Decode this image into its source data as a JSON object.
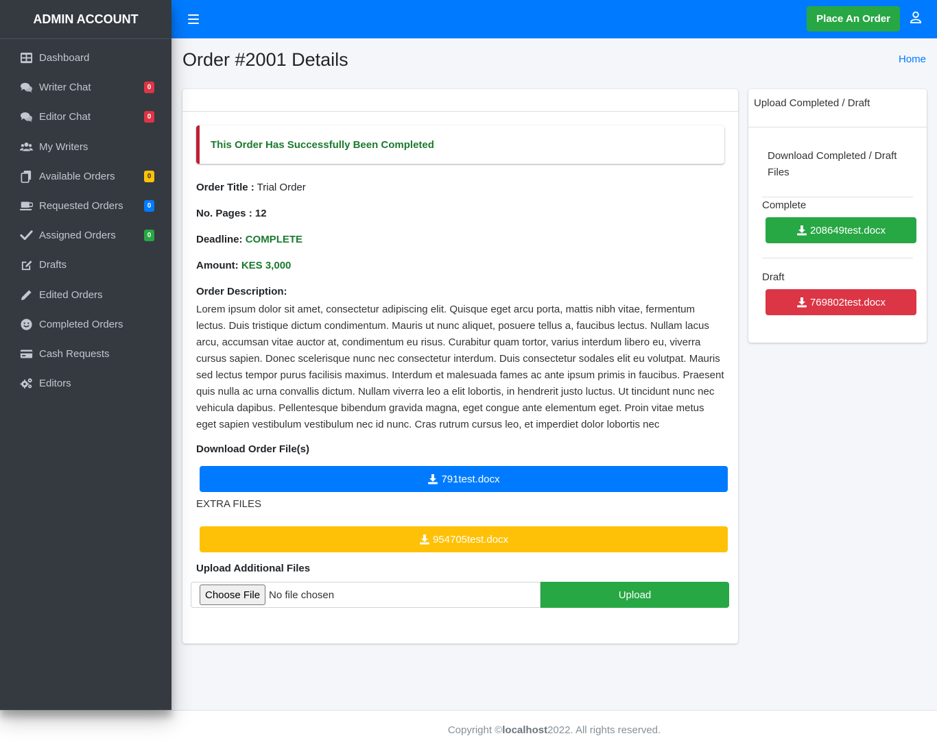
{
  "sidebar": {
    "brand": "ADMIN ACCOUNT",
    "items": [
      {
        "label": "Dashboard",
        "icon": "dashboard-icon"
      },
      {
        "label": "Writer Chat",
        "icon": "comments-icon",
        "badge": "0",
        "badge_color": "#dc3545"
      },
      {
        "label": "Editor Chat",
        "icon": "comments-icon",
        "badge": "0",
        "badge_color": "#dc3545"
      },
      {
        "label": "My Writers",
        "icon": "users-icon"
      },
      {
        "label": "Available Orders",
        "icon": "copy-icon",
        "badge": "0",
        "badge_color": "#ffc107"
      },
      {
        "label": "Requested Orders",
        "icon": "mug-icon",
        "badge": "0",
        "badge_color": "#007bff"
      },
      {
        "label": "Assigned Orders",
        "icon": "check-icon",
        "badge": "0",
        "badge_color": "#28a745"
      },
      {
        "label": "Drafts",
        "icon": "edit-icon"
      },
      {
        "label": "Edited Orders",
        "icon": "pencil-icon"
      },
      {
        "label": "Completed Orders",
        "icon": "smile-icon"
      },
      {
        "label": "Cash Requests",
        "icon": "credit-card-icon"
      },
      {
        "label": "Editors",
        "icon": "cogs-icon"
      }
    ]
  },
  "topbar": {
    "menu_icon": "hamburger-icon",
    "place_order_label": "Place An Order",
    "user_icon": "user-icon"
  },
  "header": {
    "title": "Order #2001 Details",
    "breadcrumb_home": "Home"
  },
  "order": {
    "status_message": "This Order Has Successfully Been Completed",
    "title_label": "Order Title :",
    "title_value": "Trial Order",
    "pages_label": "No. Pages :",
    "pages_value": "12",
    "deadline_label": "Deadline:",
    "deadline_value": "COMPLETE",
    "amount_label": "Amount:",
    "amount_value": "KES 3,000",
    "description_label": "Order Description:",
    "description": "Lorem ipsum dolor sit amet, consectetur adipiscing elit. Quisque eget arcu porta, mattis nibh vitae, fermentum lectus. Duis tristique dictum condimentum. Mauris ut nunc aliquet, posuere tellus a, faucibus lectus. Nullam lacus arcu, accumsan vitae auctor at, condimentum eu risus. Curabitur quam tortor, varius interdum libero eu, viverra cursus sapien. Donec scelerisque nunc nec consectetur interdum. Duis consectetur sodales elit eu volutpat. Mauris sed lectus tempor purus facilisis maximus. Interdum et malesuada fames ac ante ipsum primis in faucibus. Praesent quis nulla ac urna convallis dictum. Nullam viverra leo a elit lobortis, in hendrerit justo luctus. Ut tincidunt nunc nec vehicula dapibus. Pellentesque bibendum gravida magna, eget congue ante elementum eget. Proin vitae metus eget sapien vestibulum vestibulum nec id nunc. Cras rutrum cursus leo, et imperdiet dolor lobortis nec",
    "download_label": "Download Order File(s)",
    "order_file": "791test.docx",
    "extra_files_label": "EXTRA FILES",
    "extra_file": "954705test.docx",
    "upload_label": "Upload Additional Files",
    "choose_file_label": "Choose File",
    "no_file_text": "No file chosen",
    "upload_button": "Upload"
  },
  "side": {
    "header": "Upload Completed / Draft",
    "subtitle": "Download Completed / Draft Files",
    "complete_label": "Complete",
    "complete_file": "208649test.docx",
    "draft_label": "Draft",
    "draft_file": "769802test.docx"
  },
  "footer": {
    "prefix": "Copyright © ",
    "host": "localhost",
    "suffix": " 2022. All rights reserved."
  },
  "colors": {
    "sidebar_bg": "#343a40",
    "topbar_bg": "#007bff",
    "success": "#28a745",
    "danger": "#dc3545",
    "warning": "#ffc107"
  }
}
